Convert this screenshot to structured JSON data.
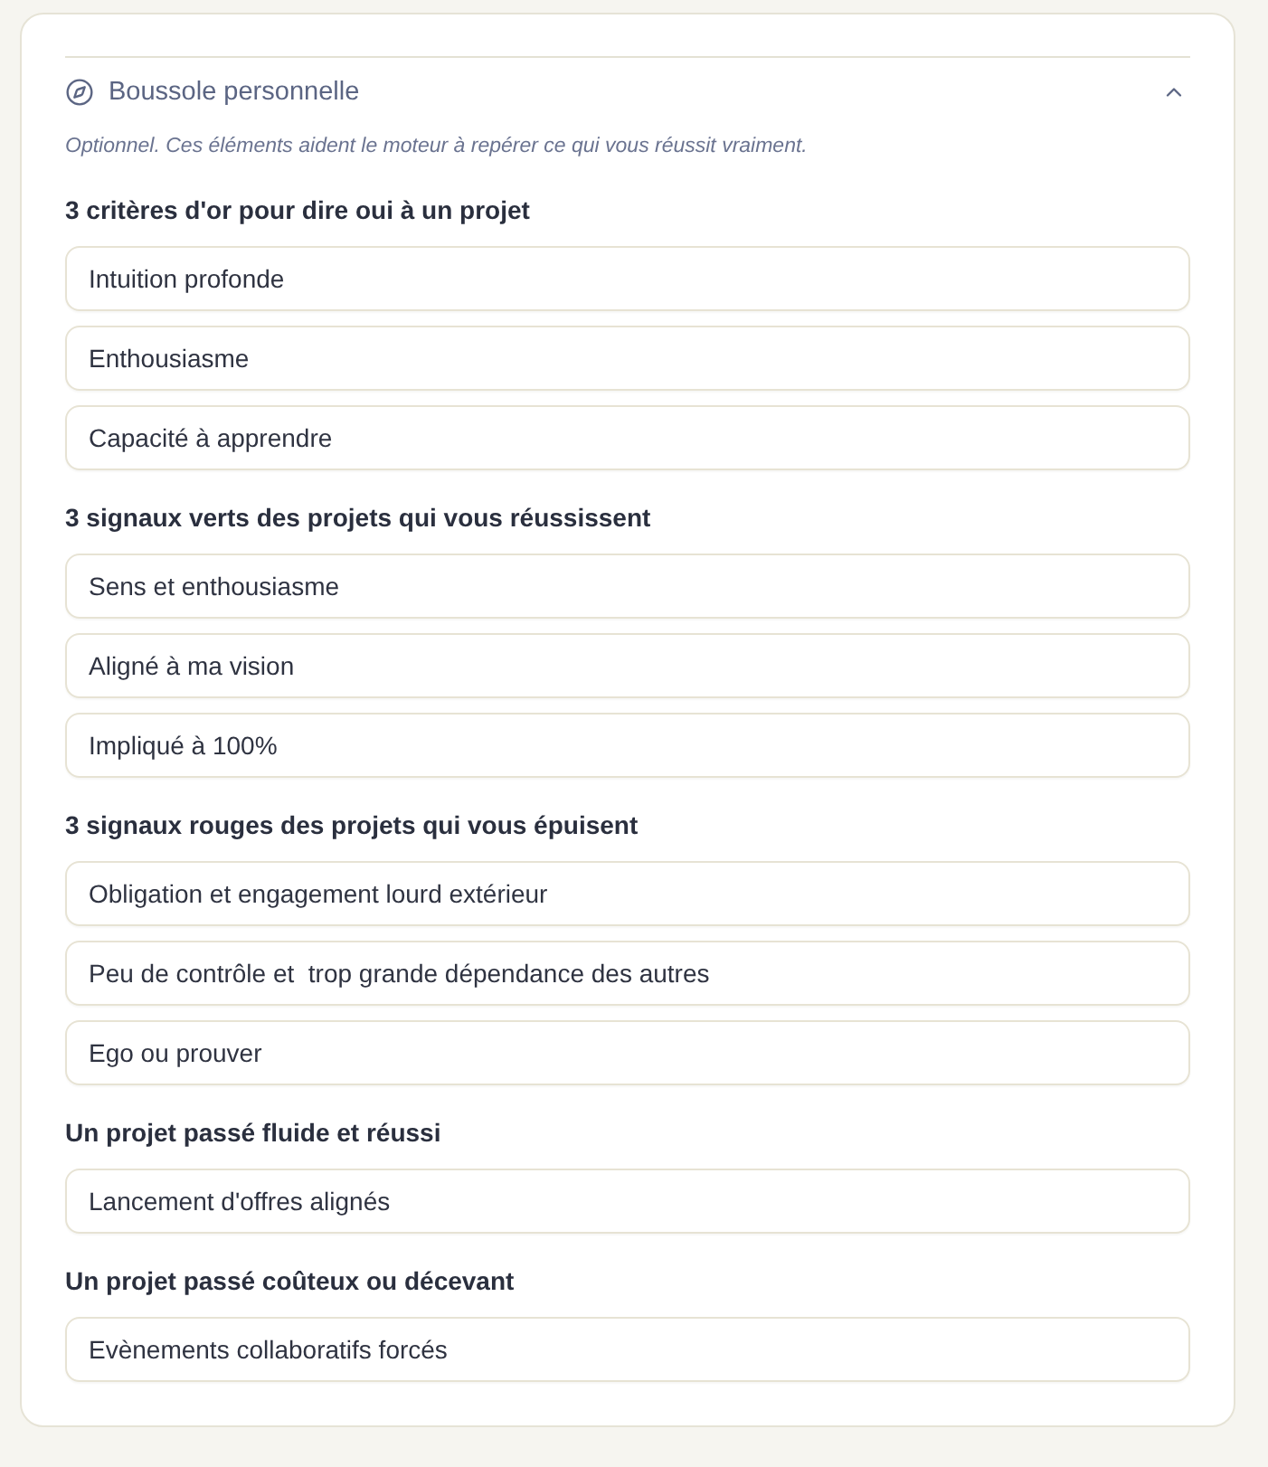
{
  "compass_section": {
    "title": "Boussole personnelle",
    "expanded": true,
    "hint": "Optionnel. Ces éléments aident le moteur à repérer ce qui vous réussit vraiment.",
    "groups": [
      {
        "label": "3 critères d'or pour dire oui à un projet",
        "fields": [
          "Intuition profonde",
          "Enthousiasme",
          "Capacité à apprendre"
        ]
      },
      {
        "label": "3 signaux verts des projets qui vous réussissent",
        "fields": [
          "Sens et enthousiasme",
          "Aligné à ma vision",
          "Impliqué à 100%"
        ]
      },
      {
        "label": "3 signaux rouges des projets qui vous épuisent",
        "fields": [
          "Obligation et engagement lourd extérieur",
          "Peu de contrôle et  trop grande dépendance des autres",
          "Ego ou prouver"
        ]
      },
      {
        "label": "Un projet passé fluide et réussi",
        "fields": [
          "Lancement d'offres alignés"
        ]
      },
      {
        "label": "Un projet passé coûteux ou décevant",
        "fields": [
          "Evènements collaboratifs forcés"
        ]
      }
    ]
  }
}
